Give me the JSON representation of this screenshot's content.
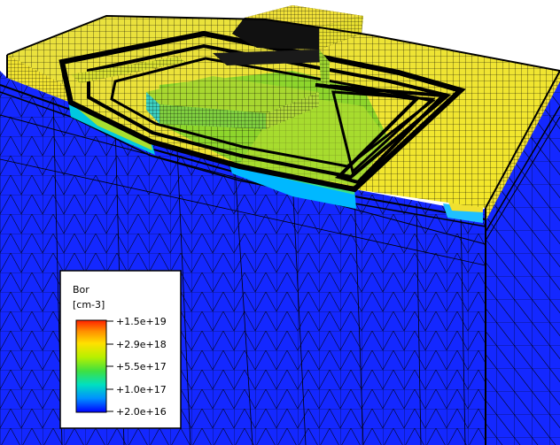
{
  "legend": {
    "quantity": "Bor",
    "unit": "[cm-3]",
    "ticks": [
      "+1.5e+19",
      "+2.9e+18",
      "+5.5e+17",
      "+1.0e+17",
      "+2.0e+16"
    ],
    "scale": "log",
    "colormap": [
      "#ff0000",
      "#ffd000",
      "#ffff00",
      "#a0e000",
      "#00e060",
      "#00e0e0",
      "#0090ff",
      "#0000ff"
    ]
  },
  "colors": {
    "substrate": "#1428ff",
    "yellow_region": "#f0ea30",
    "green_region": "#86d62a",
    "mesh": "#000000"
  }
}
